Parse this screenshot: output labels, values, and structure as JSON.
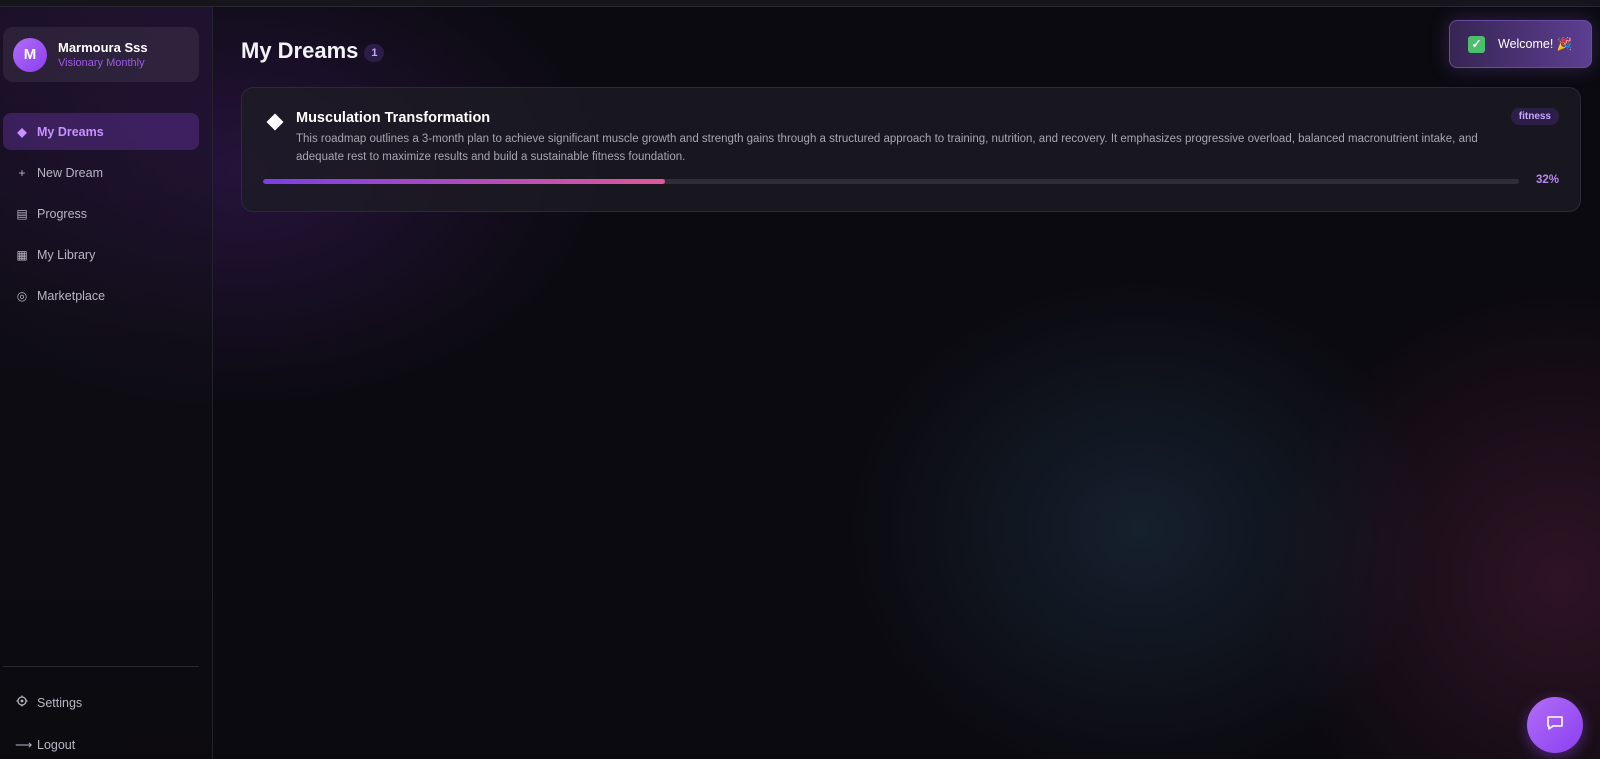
{
  "profile": {
    "initial": "M",
    "name": "Marmoura Sss",
    "plan": "Visionary Monthly"
  },
  "nav": {
    "items": [
      {
        "label": "My Dreams",
        "icon": "diamond-icon",
        "glyph": "◆",
        "active": true
      },
      {
        "label": "New Dream",
        "icon": "plus-icon",
        "glyph": "+",
        "active": false
      },
      {
        "label": "Progress",
        "icon": "list-icon",
        "glyph": "▤",
        "active": false
      },
      {
        "label": "My Library",
        "icon": "grid-icon",
        "glyph": "▦",
        "active": false
      },
      {
        "label": "Marketplace",
        "icon": "target-icon",
        "glyph": "◎",
        "active": false
      }
    ],
    "settings_label": "Settings",
    "logout_label": "Logout"
  },
  "main": {
    "title": "My Dreams",
    "count": "1"
  },
  "dreams": [
    {
      "title": "Musculation Transformation",
      "description": "This roadmap outlines a 3-month plan to achieve significant muscle growth and strength gains through a structured approach to training, nutrition, and recovery. It emphasizes progressive overload, balanced macronutrient intake, and adequate rest to maximize results and build a sustainable fitness foundation.",
      "tag": "fitness",
      "progress": 0.32,
      "progress_label": "32%"
    }
  ],
  "toast": {
    "text": "Welcome! 🎉"
  },
  "colors": {
    "accent": "#8a3ff0",
    "accent_light": "#c792ff",
    "progress_end": "#e0579a",
    "background": "#0b0a10"
  }
}
